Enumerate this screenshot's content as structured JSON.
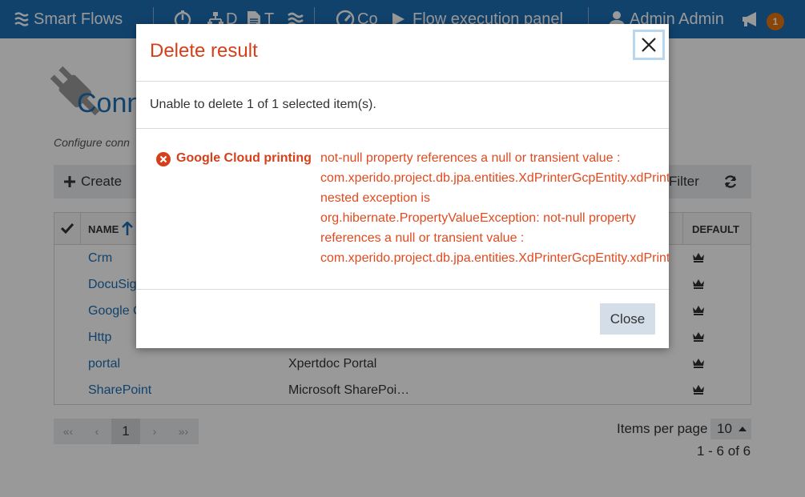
{
  "nav": {
    "brand": "Smart Flows",
    "item_d": "D",
    "item_t": "T",
    "item_co": "Co",
    "flow_panel": "Flow execution panel",
    "user": "Admin Admin",
    "notification_count": "1"
  },
  "page": {
    "title": "Conn",
    "subtitle": "Configure conn",
    "create_label": "Create",
    "filter_label": "Filter"
  },
  "grid": {
    "columns": {
      "name": "NAME",
      "default": "DEFAULT"
    },
    "rows": [
      {
        "name": "Crm",
        "description": ""
      },
      {
        "name": "DocuSign",
        "description": ""
      },
      {
        "name": "Google Cloud printing",
        "description": ""
      },
      {
        "name": "Http",
        "description": ""
      },
      {
        "name": "portal",
        "description": "Xpertdoc Portal"
      },
      {
        "name": "SharePoint",
        "description": "Microsoft SharePoi…"
      }
    ]
  },
  "pager": {
    "first": "«‹",
    "prev": "‹",
    "current": "1",
    "next": "›",
    "last": "»›",
    "items_per_page_label": "Items per page",
    "items_per_page": "10",
    "range": "1 - 6 of 6"
  },
  "modal": {
    "title": "Delete result",
    "message": "Unable to delete 1 of 1 selected item(s).",
    "error_item": "Google Cloud printing",
    "error_lines": [
      "not-null property references a null or transient value :",
      "com.xperido.project.db.jpa.entities.XdPrinterGcpEntity.xdPrinterByPrinter;",
      "nested exception is",
      "org.hibernate.PropertyValueException: not-null property",
      "references a null or transient value :",
      "com.xperido.project.db.jpa.entities.XdPrinterGcpEntity.xdPrinterByPrinter"
    ],
    "close_label": "Close"
  },
  "colors": {
    "brand_blue": "#1d6eb5",
    "error_red": "#d5401a",
    "badge_orange": "#e8730c"
  },
  "icons": [
    "waves-icon",
    "dashboard-icon",
    "sitemap-icon",
    "file-text-icon",
    "waves-icon",
    "speedometer-icon",
    "play-icon",
    "user-icon",
    "megaphone-icon",
    "plug-icon",
    "plus-icon",
    "refresh-icon",
    "checkmark-icon",
    "sort-up-icon",
    "crown-icon",
    "error-circle-icon",
    "close-icon",
    "caret-up-icon"
  ]
}
